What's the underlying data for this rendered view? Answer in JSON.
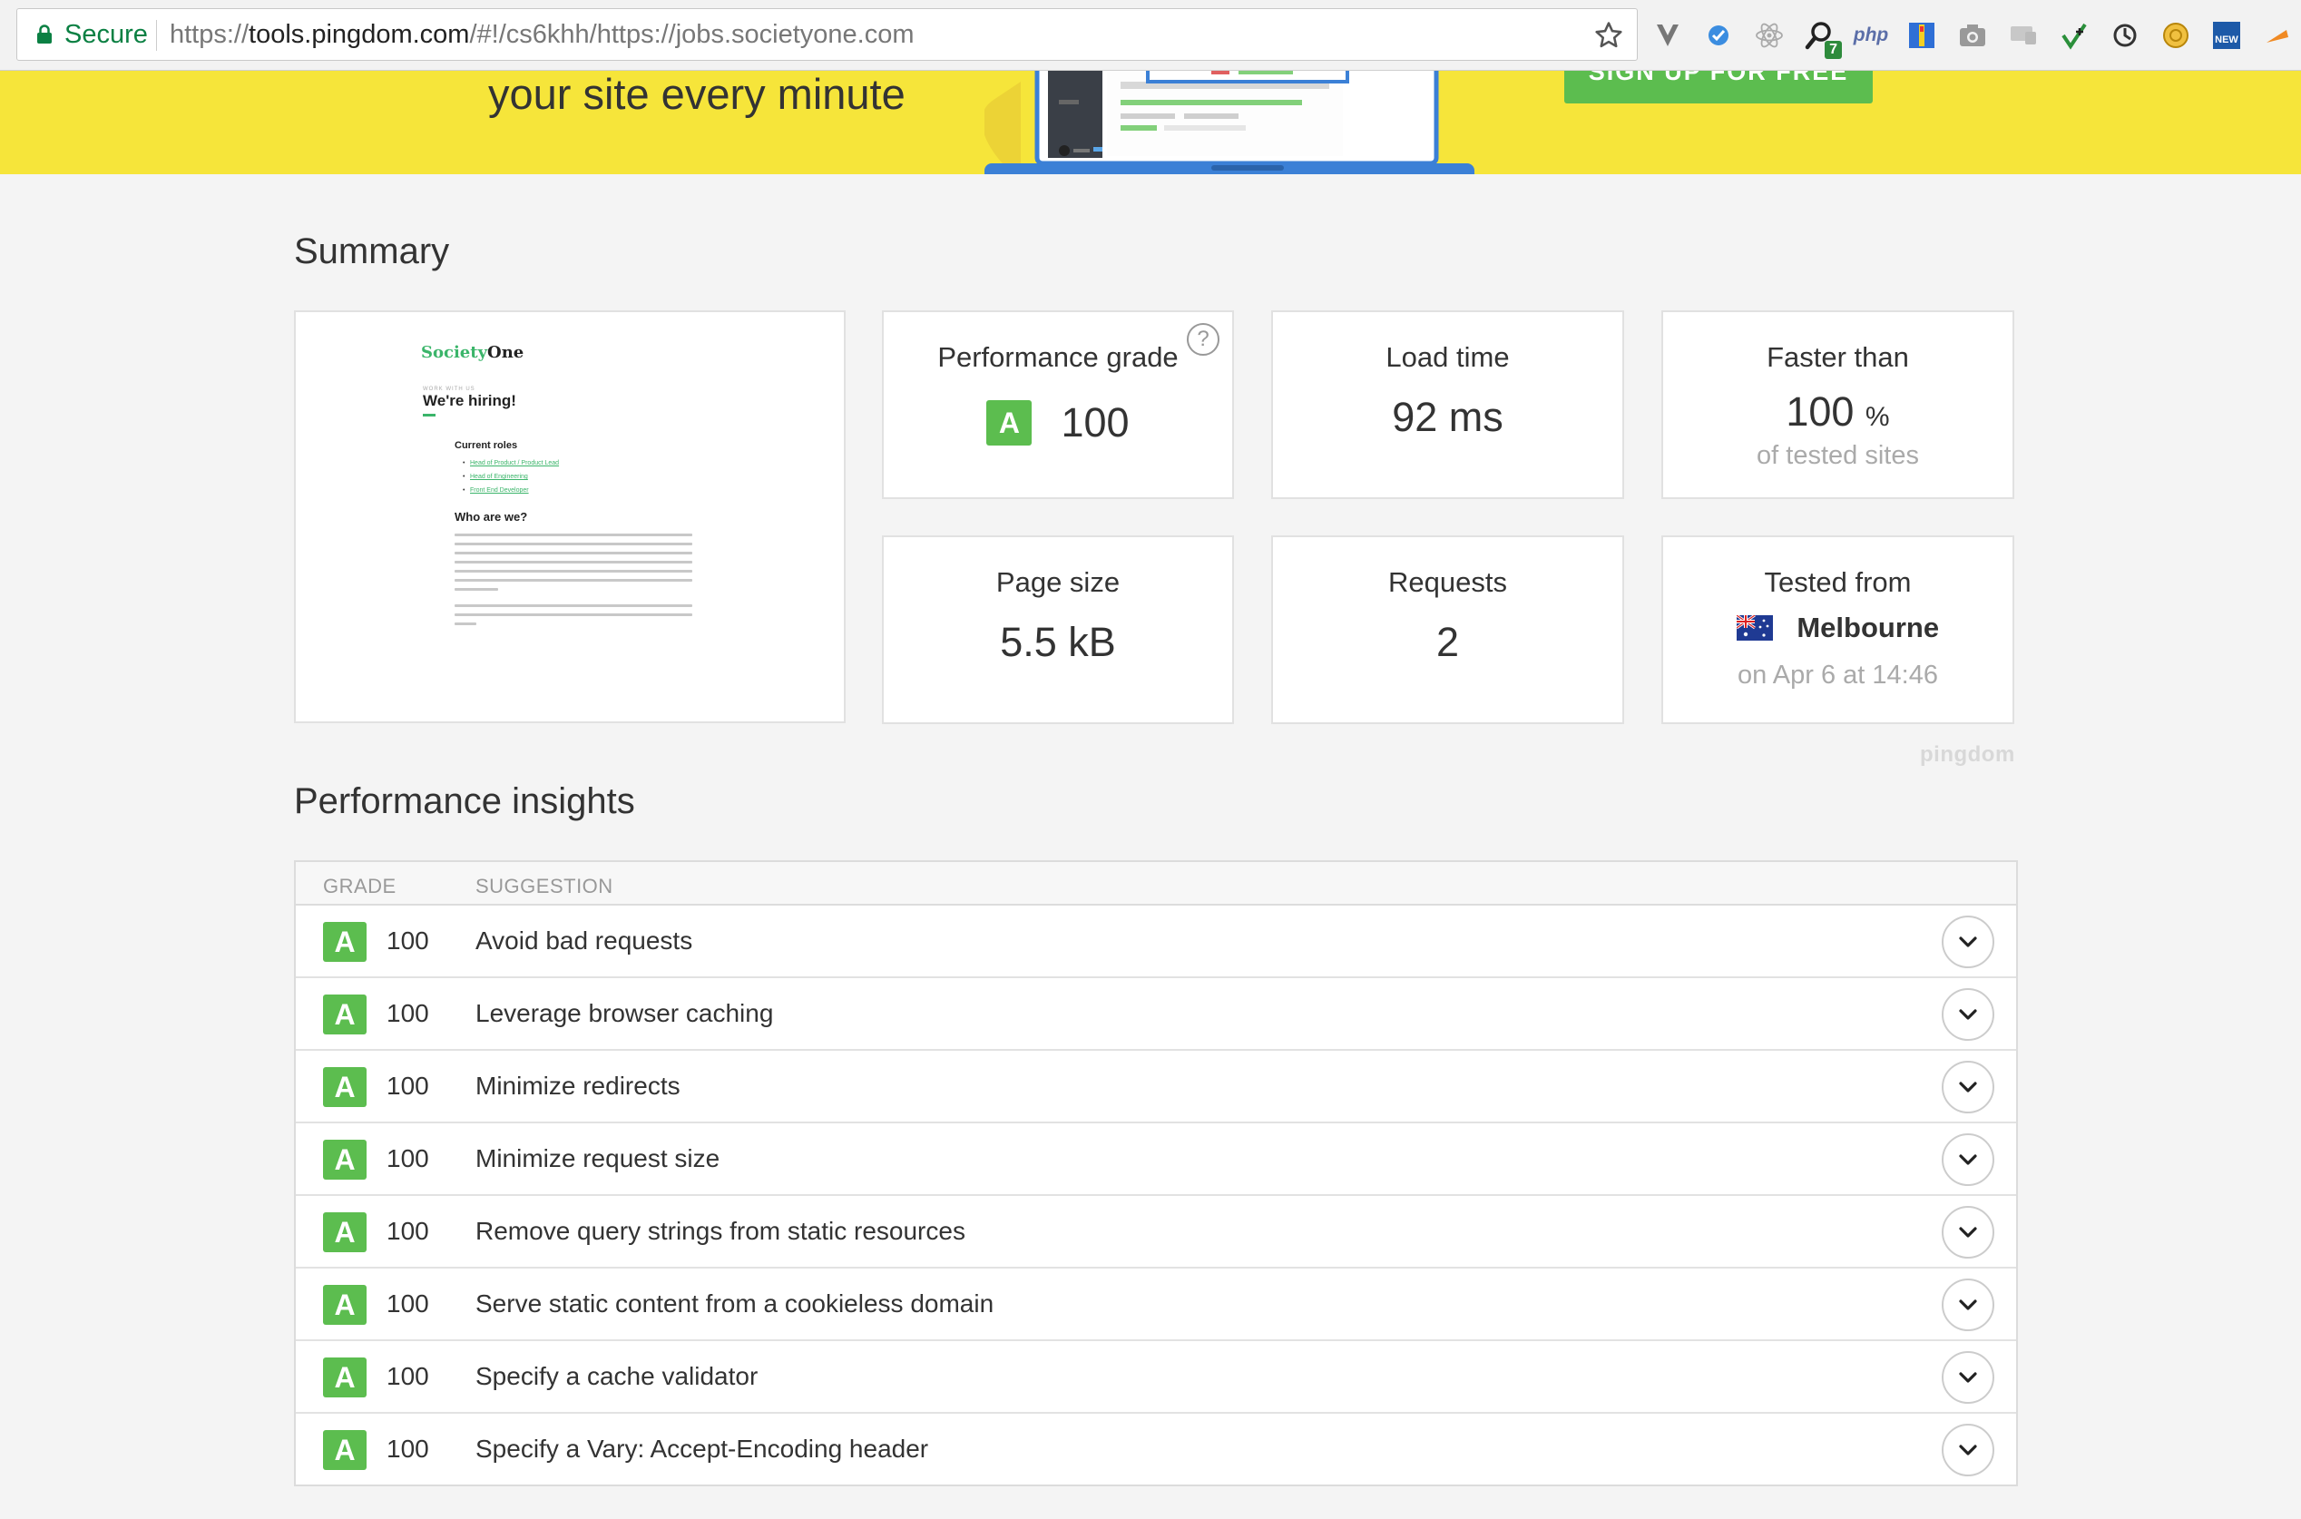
{
  "browser": {
    "secure_label": "Secure",
    "url": {
      "scheme": "https://",
      "host": "tools.pingdom.com",
      "path": "/#!/cs6khh/https://jobs.societyone.com"
    },
    "extensions": [
      "vivaldi-icon",
      "check-icon",
      "react-icon",
      "search-badge-icon",
      "php-icon",
      "ruler-icon",
      "camera-icon",
      "cast-icon",
      "arrows-icon",
      "refresh-icon",
      "coin-icon",
      "new-icon",
      "arrow-icon"
    ],
    "ext_badge": "7",
    "php_label": "php",
    "new_label": "NEW"
  },
  "hero": {
    "tagline": "your site every minute",
    "cta_label": "SIGN UP FOR FREE"
  },
  "summary": {
    "title": "Summary",
    "preview": {
      "logo_a": "Society",
      "logo_b": "One",
      "kicker": "WORK WITH US",
      "heading": "We're hiring!",
      "roles_title": "Current roles",
      "roles": [
        "Head of Product / Product Lead",
        "Head of Engineering",
        "Front End Developer"
      ],
      "about_title": "Who are we?"
    },
    "performance_grade": {
      "label": "Performance grade",
      "grade": "A",
      "value": "100",
      "help": "?"
    },
    "load_time": {
      "label": "Load time",
      "value": "92 ms"
    },
    "faster_than": {
      "label": "Faster than",
      "value": "100",
      "unit": "%",
      "sub": "of tested sites"
    },
    "page_size": {
      "label": "Page size",
      "value": "5.5 kB"
    },
    "requests": {
      "label": "Requests",
      "value": "2"
    },
    "tested_from": {
      "label": "Tested from",
      "location": "Melbourne",
      "sub": "on Apr 6 at 14:46"
    },
    "brand": "pingdom"
  },
  "insights": {
    "title": "Performance insights",
    "columns": {
      "grade": "GRADE",
      "suggestion": "SUGGESTION"
    },
    "rows": [
      {
        "grade": "A",
        "score": "100",
        "suggestion": "Avoid bad requests"
      },
      {
        "grade": "A",
        "score": "100",
        "suggestion": "Leverage browser caching"
      },
      {
        "grade": "A",
        "score": "100",
        "suggestion": "Minimize redirects"
      },
      {
        "grade": "A",
        "score": "100",
        "suggestion": "Minimize request size"
      },
      {
        "grade": "A",
        "score": "100",
        "suggestion": "Remove query strings from static resources"
      },
      {
        "grade": "A",
        "score": "100",
        "suggestion": "Serve static content from a cookieless domain"
      },
      {
        "grade": "A",
        "score": "100",
        "suggestion": "Specify a cache validator"
      },
      {
        "grade": "A",
        "score": "100",
        "suggestion": "Specify a Vary: Accept-Encoding header"
      }
    ]
  },
  "colors": {
    "hero_yellow": "#f6e53a",
    "grade_green": "#5cbd4f",
    "secure_green": "#0b8043"
  }
}
